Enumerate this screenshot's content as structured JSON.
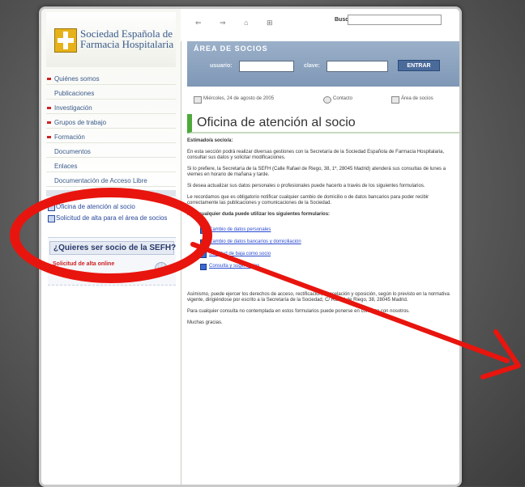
{
  "site": {
    "name": "Sociedad Española de Farmacia Hospitalaria",
    "search_label": "Buscar:"
  },
  "toolbar": {
    "icons": [
      "print-icon",
      "back-icon",
      "home-icon",
      "text-size-icon"
    ],
    "icon_glyphs": "⇐ ⇒ ⌂ ⊞"
  },
  "sidebar": {
    "items": [
      {
        "label": "Quiénes somos",
        "bullet": true
      },
      {
        "label": "Publicaciones",
        "bullet": false
      },
      {
        "label": "Investigación",
        "bullet": true
      },
      {
        "label": "Grupos de trabajo",
        "bullet": true
      },
      {
        "label": "Formación",
        "bullet": true
      },
      {
        "label": "Documentos",
        "bullet": false
      },
      {
        "label": "Enlaces",
        "bullet": false
      },
      {
        "label": "Documentación de Acceso Libre",
        "bullet": false
      }
    ],
    "box_lines": [
      "Oficina de atención al socio",
      "Solicitud de alta para el área de socios"
    ],
    "join_title": "¿Quieres ser socio de la SEFH?",
    "join_link": "Solicitud de alta online"
  },
  "login": {
    "title": "ÁREA DE SOCIOS",
    "user_label": "usuario:",
    "pass_label": "clave:",
    "button": "ENTRAR"
  },
  "info_bar": {
    "date": "Miércoles, 24 de agosto de 2005",
    "contact": "Contacto",
    "members": "Área de socios"
  },
  "page": {
    "title": "Oficina de atención al socio",
    "paragraphs": [
      {
        "text": "Estimado/a socio/a:",
        "bold": true
      },
      {
        "text": "En esta sección podrá realizar diversas gestiones con la Secretaría de la Sociedad Española de Farmacia Hospitalaria, consultar sus datos y solicitar modificaciones.",
        "bold": false
      },
      {
        "text": "Si lo prefiere, la Secretaría de la SEFH (Calle Rafael de Riego, 38, 1º, 28045 Madrid) atenderá sus consultas de lunes a viernes en horario de mañana y tarde.",
        "bold": false
      },
      {
        "text": "Si desea actualizar sus datos personales o profesionales puede hacerlo a través de los siguientes formularios.",
        "bold": false
      },
      {
        "text": "Le recordamos que es obligatorio notificar cualquier cambio de domicilio o de datos bancarios para poder recibir correctamente las publicaciones y comunicaciones de la Sociedad.",
        "bold": false
      },
      {
        "text": "Para cualquier duda puede utilizar los siguientes formularios:",
        "bold": false
      }
    ],
    "links": [
      "Cambio de datos personales",
      "Cambio de datos bancarios y domiciliación",
      "Solicitud de baja como socio",
      "Consulta y sugerencias"
    ],
    "footer_paragraphs": [
      "Asimismo, puede ejercer los derechos de acceso, rectificación, cancelación y oposición, según lo previsto en la normativa vigente, dirigiéndose por escrito a la Secretaría de la Sociedad, C/ Rafael de Riego, 38, 28045 Madrid.",
      "Para cualquier consulta no contemplada en estos formularios puede ponerse en contacto con nosotros.",
      "Muchas gracias."
    ]
  }
}
